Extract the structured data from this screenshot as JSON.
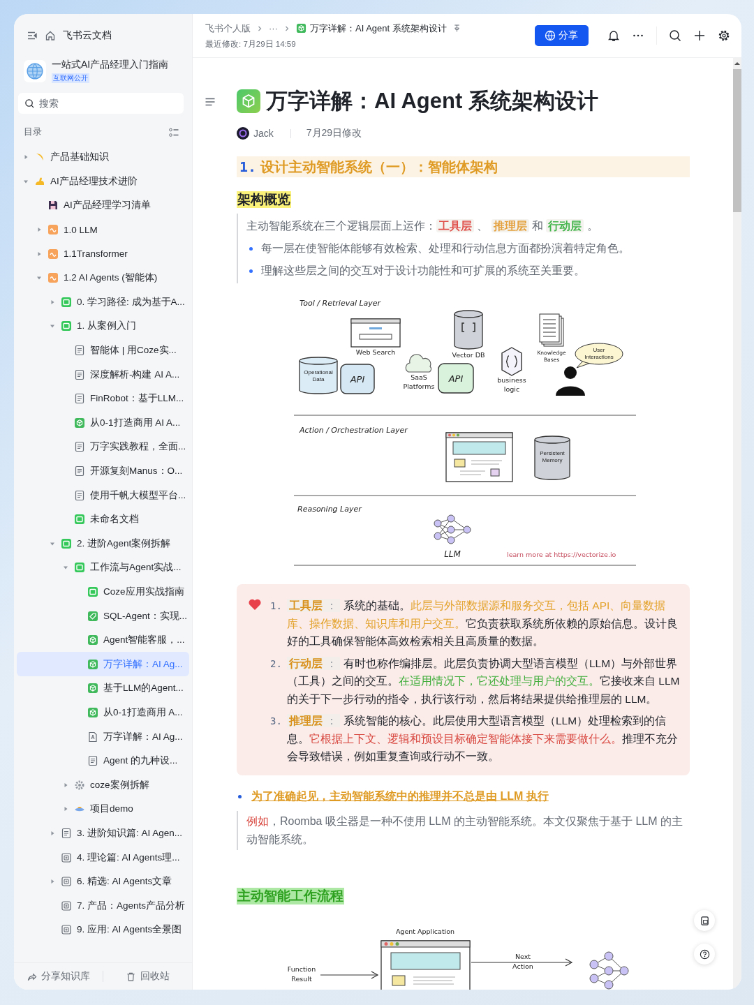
{
  "sidebar": {
    "app_title": "飞书云文档",
    "space": {
      "name": "一站式AI产品经理入门指南",
      "badge": "互联网公开"
    },
    "search": {
      "placeholder": "搜索"
    },
    "toc_label": "目录",
    "tree": [
      {
        "label": "产品基础知识",
        "kind": "crescent",
        "expanded": false,
        "selected": false
      },
      {
        "label": "AI产品经理技术进阶",
        "kind": "arm",
        "expanded": true,
        "selected": false,
        "children": [
          {
            "label": "AI产品经理学习清单",
            "kind": "save",
            "selected": false
          },
          {
            "label": "1.0 LLM",
            "kind": "wave",
            "expanded": false,
            "selected": false
          },
          {
            "label": "1.1Transformer",
            "kind": "wave",
            "expanded": false,
            "selected": false
          },
          {
            "label": "1.2 AI Agents (智能体)",
            "kind": "wave",
            "expanded": true,
            "selected": false,
            "children": [
              {
                "label": "0. 学习路径: 成为基于A...",
                "kind": "board",
                "expanded": false,
                "selected": false
              },
              {
                "label": "1. 从案例入门",
                "kind": "board",
                "expanded": true,
                "selected": false,
                "children": [
                  {
                    "label": "智能体 | 用Coze实...",
                    "kind": "doc",
                    "selected": false
                  },
                  {
                    "label": "深度解析-构建 AI A...",
                    "kind": "doc",
                    "selected": false
                  },
                  {
                    "label": "FinRobot：基于LLM...",
                    "kind": "doc",
                    "selected": false
                  },
                  {
                    "label": "从0-1打造商用 AI A...",
                    "kind": "cube",
                    "selected": false
                  },
                  {
                    "label": "万字实践教程，全面...",
                    "kind": "doc",
                    "selected": false
                  },
                  {
                    "label": "开源复刻Manus：O...",
                    "kind": "doc",
                    "selected": false
                  },
                  {
                    "label": "使用千帆大模型平台...",
                    "kind": "doc",
                    "selected": false
                  },
                  {
                    "label": "未命名文档",
                    "kind": "board",
                    "selected": false
                  }
                ]
              },
              {
                "label": "2. 进阶Agent案例拆解",
                "kind": "board",
                "expanded": true,
                "selected": false,
                "children": [
                  {
                    "label": "工作流与Agent实战...",
                    "kind": "board",
                    "expanded": true,
                    "selected": false,
                    "children": [
                      {
                        "label": "Coze应用实战指南",
                        "kind": "board",
                        "selected": false
                      },
                      {
                        "label": "SQL-Agent：实现...",
                        "kind": "tag",
                        "selected": false
                      },
                      {
                        "label": "Agent智能客服，...",
                        "kind": "cube",
                        "selected": false
                      },
                      {
                        "label": "万字详解：AI Ag...",
                        "kind": "cube",
                        "selected": true
                      },
                      {
                        "label": "基于LLM的Agent...",
                        "kind": "cube",
                        "selected": false
                      },
                      {
                        "label": "从0-1打造商用 A...",
                        "kind": "cube",
                        "selected": false
                      },
                      {
                        "label": "万字详解：AI Ag...",
                        "kind": "file",
                        "selected": false
                      },
                      {
                        "label": "Agent 的九种设...",
                        "kind": "doc",
                        "selected": false
                      }
                    ]
                  },
                  {
                    "label": "coze案例拆解",
                    "kind": "gear",
                    "expanded": false,
                    "selected": false
                  },
                  {
                    "label": "项目demo",
                    "kind": "ufo",
                    "expanded": false,
                    "selected": false
                  }
                ]
              },
              {
                "label": "3. 进阶知识篇: AI Agen...",
                "kind": "doc",
                "expanded": false,
                "selected": false
              },
              {
                "label": "4. 理论篇: AI Agents理...",
                "kind": "plussq",
                "selected": false
              },
              {
                "label": "6. 精选: AI Agents文章",
                "kind": "plussq",
                "expanded": false,
                "selected": false
              },
              {
                "label": "7. 产品：Agents产品分析",
                "kind": "plussq",
                "selected": false
              },
              {
                "label": "9. 应用: AI Agents全景图",
                "kind": "plussq",
                "selected": false
              }
            ]
          }
        ]
      }
    ],
    "footer": [
      {
        "label": "分享知识库",
        "kind": "share"
      },
      {
        "label": "回收站",
        "kind": "trash"
      }
    ]
  },
  "header": {
    "breadcrumb": [
      "飞书个人版",
      "···",
      "万字详解：AI Agent 系统架构设计"
    ],
    "modified": "最近修改: 7月29日 14:59",
    "share_button": "分享"
  },
  "doc": {
    "title": "万字详解：AI Agent 系统架构设计",
    "author": "Jack",
    "edited": "7月29日修改",
    "blocks": [
      {
        "kind": "h2",
        "number": "1.",
        "text": "设计主动智能系统（一）：智能体架构"
      },
      {
        "kind": "h3",
        "text": "架构概览"
      },
      {
        "kind": "quote",
        "lines": [
          {
            "kind": "para",
            "segments": [
              {
                "kind": "plain",
                "text": "主动智能系统在三个逻辑层面上运作："
              },
              {
                "kind": "tag-red",
                "text": "工具层"
              },
              {
                "kind": "plain",
                "text": " 、 "
              },
              {
                "kind": "tag-orange",
                "text": "推理层"
              },
              {
                "kind": "plain",
                "text": " 和 "
              },
              {
                "kind": "tag-green",
                "text": "行动层"
              },
              {
                "kind": "plain",
                "text": " 。"
              }
            ]
          },
          {
            "kind": "bullet",
            "segments": [
              {
                "kind": "plain",
                "text": "每一层在使智能体能够有效检索、处理和行动信息方面都扮演着特定角色。"
              }
            ]
          },
          {
            "kind": "bullet",
            "segments": [
              {
                "kind": "plain",
                "text": "理解这些层之间的交互对于设计功能性和可扩展的系统至关重要。"
              }
            ]
          }
        ]
      },
      {
        "kind": "diagram",
        "note": "learn more at https://vectorize.io",
        "layers": [
          {
            "title": "Tool / Retrieval Layer",
            "nodes": [
              {
                "kind": "browser",
                "label": "Web Search"
              },
              {
                "kind": "cylinder",
                "label": "Vector DB",
                "color": "#cfd3d9"
              },
              {
                "kind": "docs",
                "label": "Knowledge Bases"
              },
              {
                "kind": "cylinder",
                "label": "Operational Data",
                "color": "#dcecf7"
              },
              {
                "kind": "api",
                "label": "API",
                "color": "#d6e8f3"
              },
              {
                "kind": "cloud",
                "label": "SaaS Platforms"
              },
              {
                "kind": "api",
                "label": "API",
                "color": "#d9f2dc"
              },
              {
                "kind": "hexagon",
                "label": "business logic"
              },
              {
                "kind": "person",
                "label": "User Interactions"
              }
            ]
          },
          {
            "title": "Action / Orchestration Layer",
            "nodes": [
              {
                "kind": "app"
              },
              {
                "kind": "cylinder",
                "label": "Persistent Memory",
                "color": "#cfd3d9"
              }
            ]
          },
          {
            "title": "Reasoning Layer",
            "nodes": [
              {
                "kind": "network",
                "label": "LLM"
              }
            ]
          }
        ]
      },
      {
        "kind": "callout",
        "items": [
          {
            "number": "1.",
            "term": "工具层",
            "separator": "：",
            "segments": [
              {
                "kind": "plain",
                "text": "系统的基础。"
              },
              {
                "kind": "orange",
                "text": "此层与外部数据源和服务交互，包括 API、向量数据库、操作数据、知识库和用户交互。"
              },
              {
                "kind": "plain",
                "text": "它负责获取系统所依赖的原始信息。设计良好的工具确保智能体高效检索相关且高质量的数据。"
              }
            ]
          },
          {
            "number": "2.",
            "term": "行动层",
            "separator": "：",
            "segments": [
              {
                "kind": "plain",
                "text": "有时也称作编排层。此层负责协调大型语言模型（LLM）与外部世界（工具）之间的交互。"
              },
              {
                "kind": "green",
                "text": "在适用情况下，它还处理与用户的交互。"
              },
              {
                "kind": "plain",
                "text": "它接收来自 LLM 的关于下一步行动的指令，执行该行动，然后将结果提供给推理层的 LLM。"
              }
            ]
          },
          {
            "number": "3.",
            "term": "推理层",
            "separator": "：",
            "segments": [
              {
                "kind": "plain",
                "text": "系统智能的核心。此层使用大型语言模型（LLM）处理检索到的信息。"
              },
              {
                "kind": "red",
                "text": "它根据上下文、逻辑和预设目标确定智能体接下来需要做什么。"
              },
              {
                "kind": "plain",
                "text": "推理不充分会导致错误，例如重复查询或行动不一致。"
              }
            ]
          }
        ]
      },
      {
        "kind": "bullet",
        "text": "为了准确起见，主动智能系统中的推理并不总是由 LLM 执行"
      },
      {
        "kind": "quote",
        "lines": [
          {
            "kind": "para",
            "segments": [
              {
                "kind": "red",
                "text": "例如"
              },
              {
                "kind": "plain",
                "text": "，Roomba 吸尘器是一种不使用 LLM 的主动智能系统。本文仅聚焦于基于 LLM 的主动智能系统。"
              }
            ]
          }
        ]
      },
      {
        "kind": "h3-green",
        "text": "主动智能工作流程"
      },
      {
        "kind": "flow",
        "nodes": [
          {
            "kind": "app",
            "label": "Agent Application"
          },
          {
            "kind": "arrow-in",
            "label": "Function Result"
          },
          {
            "kind": "arrow-out",
            "label": "Next Action"
          },
          {
            "kind": "network"
          }
        ]
      }
    ]
  }
}
